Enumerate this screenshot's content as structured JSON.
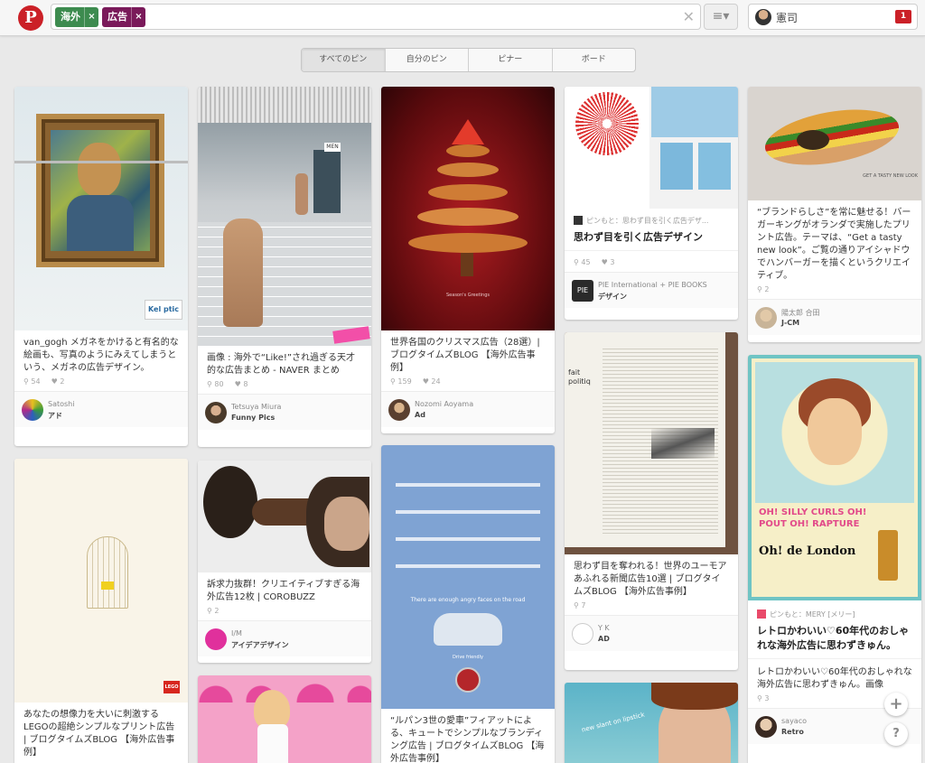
{
  "header": {
    "logo": "P",
    "search_chips": [
      {
        "label": "海外",
        "color": "#3d8b4f"
      },
      {
        "label": "広告",
        "color": "#7a1a5a"
      }
    ],
    "chip_remove": "×",
    "clear": "✕",
    "menu": "≡▾",
    "user_name": "憲司",
    "notification_count": "1"
  },
  "tabs": [
    "すべてのピン",
    "自分のピン",
    "ピナー",
    "ボード"
  ],
  "pins": [
    {
      "desc": "van_gogh メガネをかけると有名的な絵画も、写真のようにみえてしまうという、メガネの広告デザイン。",
      "repins": "54",
      "likes": "2",
      "user": "Satoshi",
      "board": "アド",
      "img_text": "Kel ptic"
    },
    {
      "desc": "画像 : 海外で“Like!”され過ぎる天才的な広告まとめ - NAVER まとめ",
      "repins": "80",
      "likes": "8",
      "user": "Tetsuya Miura",
      "board": "Funny Pics",
      "img_text": "MEN"
    },
    {
      "desc": "世界各国のクリスマス広告（28選）| ブログタイムズBLOG 【海外広告事例】",
      "repins": "159",
      "likes": "24",
      "user": "Nozomi Aoyama",
      "board": "Ad",
      "img_text": "Season's Greetings"
    },
    {
      "source": "ピンもと：思わず目を引く広告デザ...",
      "title": "思わず目を引く広告デザイン",
      "repins": "45",
      "likes": "3",
      "user": "PIE International + PIE BOOKS",
      "board": "デザイン"
    },
    {
      "desc": "“ブランドらしさ”を常に魅せる！バーガーキングがオランダで実施したプリント広告。テーマは、“Get a tasty new look”。ご覧の通りアイシャドウでハンバーガーを描くというクリエイティブ。",
      "repins": "2",
      "user": "陽太郎 合田",
      "board": "J-CM",
      "img_text": "GET A TASTY NEW LOOK"
    },
    {
      "desc": "あなたの想像力を大いに刺激するLEGOの超絶シンプルなプリント広告 | ブログタイムズBLOG 【海外広告事例】",
      "img_text": "LEGO"
    },
    {
      "desc": "訴求力抜群！クリエイティブすぎる海外広告12枚 | COROBUZZ",
      "repins": "2",
      "user": "I/M",
      "board": "アイデアデザイン"
    },
    {
      "desc": "“ルパン3世の愛車”フィアットによる、キュートでシンプルなブランディング広告 | ブログタイムズBLOG 【海外広告事例】",
      "img_text": "There are enough angry faces on the road",
      "img_text2": "Drive friendly"
    },
    {
      "desc": "思わず目を奪われる！世界のユーモアあふれる新聞広告10選 | ブログタイムズBLOG 【海外広告事例】",
      "repins": "7",
      "user": "Y K",
      "board": "AD",
      "img_text": "fait politiq"
    },
    {
      "source": "ピンもと：MERY [メリー]",
      "title": "レトロかわいい♡60年代のおしゃれな海外広告に思わずきゅん。",
      "desc": "レトロかわいい♡60年代のおしゃれな海外広告に思わずきゅん。画像",
      "repins": "3",
      "user": "sayaco",
      "board": "Retro",
      "img_text": "OH! SILLY CURLS OH! POUT OH! RAPTURE",
      "img_text2": "Oh! de London"
    },
    {
      "img_text": "new slant on lipstick"
    }
  ],
  "fab": {
    "add": "+",
    "help": "?"
  },
  "icons": {
    "repin": "pin-icon",
    "like": "heart-icon"
  },
  "colors": {
    "brand": "#cb2027",
    "background": "#e9e9e9"
  }
}
